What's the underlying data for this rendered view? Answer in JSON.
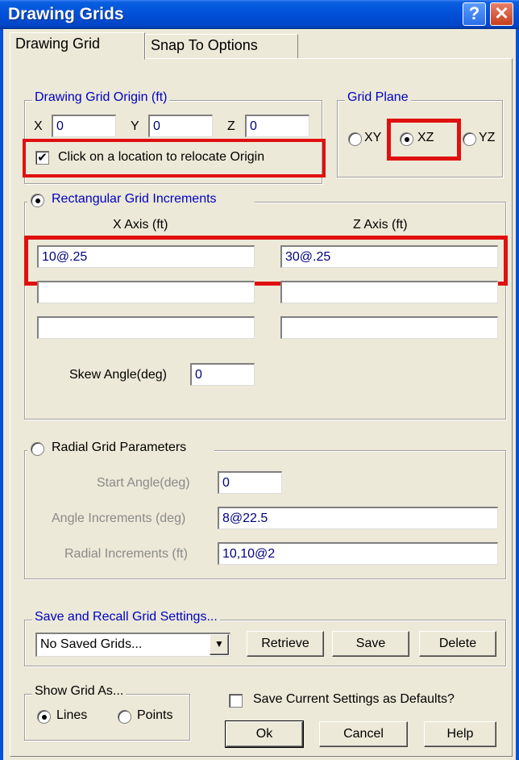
{
  "window": {
    "title": "Drawing Grids",
    "help_glyph": "?",
    "close_glyph": "✕"
  },
  "tabs": [
    {
      "label": "Drawing Grid"
    },
    {
      "label": "Snap To Options"
    }
  ],
  "origin": {
    "legend": "Drawing Grid Origin (ft)",
    "x_label": "X",
    "x_value": "0",
    "y_label": "Y",
    "y_value": "0",
    "z_label": "Z",
    "z_value": "0",
    "relocate_label": "Click on a location to relocate Origin",
    "relocate_checked": true
  },
  "grid_plane": {
    "legend": "Grid Plane",
    "options": [
      {
        "label": "XY"
      },
      {
        "label": "XZ"
      },
      {
        "label": "YZ"
      }
    ],
    "selected": "XZ"
  },
  "rectangular": {
    "label": "Rectangular Grid Increments",
    "x_axis_label": "X Axis (ft)",
    "z_axis_label": "Z Axis (ft)",
    "x_values": [
      "10@.25",
      "",
      "",
      ""
    ],
    "z_values": [
      "30@.25",
      "",
      "",
      ""
    ],
    "skew_label": "Skew Angle(deg)",
    "skew_value": "0"
  },
  "radial": {
    "label": "Radial Grid Parameters",
    "start_angle_label": "Start Angle(deg)",
    "start_angle_value": "0",
    "angle_inc_label": "Angle Increments (deg)",
    "angle_inc_value": "8@22.5",
    "radial_inc_label": "Radial Increments (ft)",
    "radial_inc_value": "10,10@2"
  },
  "saved": {
    "legend": "Save and Recall Grid Settings...",
    "select_value": "No Saved Grids...",
    "retrieve_label": "Retrieve",
    "save_label": "Save",
    "delete_label": "Delete"
  },
  "show_as": {
    "legend": "Show Grid As...",
    "lines_label": "Lines",
    "points_label": "Points",
    "selected": "Lines"
  },
  "defaults_label": "Save Current Settings as Defaults?",
  "footer": {
    "ok_label": "Ok",
    "cancel_label": "Cancel",
    "help_label": "Help"
  },
  "colors": {
    "title_bar": "#0050d8",
    "accent_text": "#0000c0",
    "highlight": "#e01010"
  }
}
